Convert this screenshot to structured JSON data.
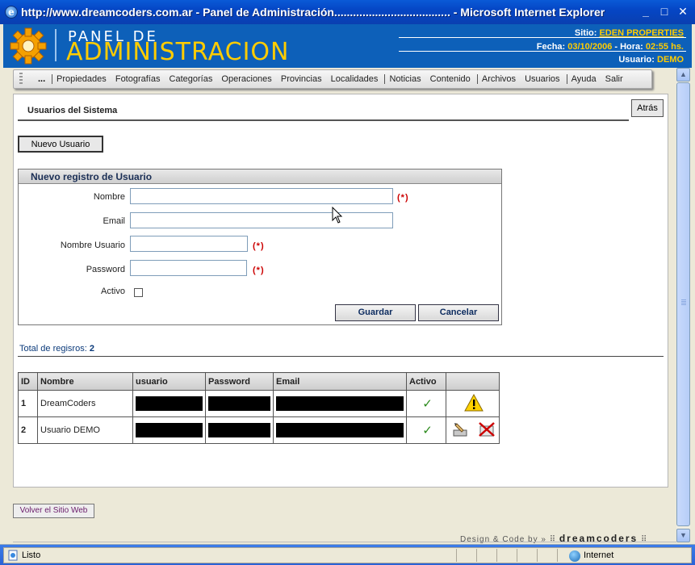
{
  "window": {
    "title": "http://www.dreamcoders.com.ar - Panel de Administración..................................... - Microsoft Internet Explorer",
    "min": "_",
    "max": "□",
    "close": "✕"
  },
  "header": {
    "title_top": "PANEL DE",
    "title_main": "ADMINISTRACION",
    "sitio_label": "Sitio:",
    "sitio_value": "EDEN PROPERTIES",
    "fecha_label": "Fecha:",
    "fecha_value": "03/10/2006",
    "hora_label": "- Hora:",
    "hora_value": "02:55 hs.",
    "usuario_label": "Usuario:",
    "usuario_value": "DEMO"
  },
  "menu": {
    "more": "...",
    "items": [
      "Propiedades",
      "Fotografías",
      "Categorías",
      "Operaciones",
      "Provincias",
      "Localidades",
      "Noticias",
      "Contenido",
      "Archivos",
      "Usuarios",
      "Ayuda",
      "Salir"
    ]
  },
  "page": {
    "section_title": "Usuarios del Sistema",
    "back_button": "Atrás",
    "new_user_button": "Nuevo Usuario"
  },
  "form": {
    "title": "Nuevo registro de Usuario",
    "fields": {
      "nombre": {
        "label": "Nombre",
        "value": ""
      },
      "email": {
        "label": "Email",
        "value": ""
      },
      "usuario": {
        "label": "Nombre Usuario",
        "value": ""
      },
      "password": {
        "label": "Password",
        "value": ""
      },
      "activo": {
        "label": "Activo"
      }
    },
    "required_mark": "(*)",
    "save_button": "Guardar",
    "cancel_button": "Cancelar"
  },
  "table": {
    "total_label": "Total de regisros:",
    "total_value": "2",
    "headers": [
      "ID",
      "Nombre",
      "usuario",
      "Password",
      "Email",
      "Activo",
      ""
    ],
    "rows": [
      {
        "id": "1",
        "nombre": "DreamCoders",
        "activo": "✓"
      },
      {
        "id": "2",
        "nombre": "Usuario DEMO",
        "activo": "✓"
      }
    ]
  },
  "footer": {
    "volver": "Volver el Sitio Web",
    "design": "Design & Code by »",
    "brand": "dreamcoders"
  },
  "statusbar": {
    "left": "Listo",
    "zone": "Internet"
  }
}
